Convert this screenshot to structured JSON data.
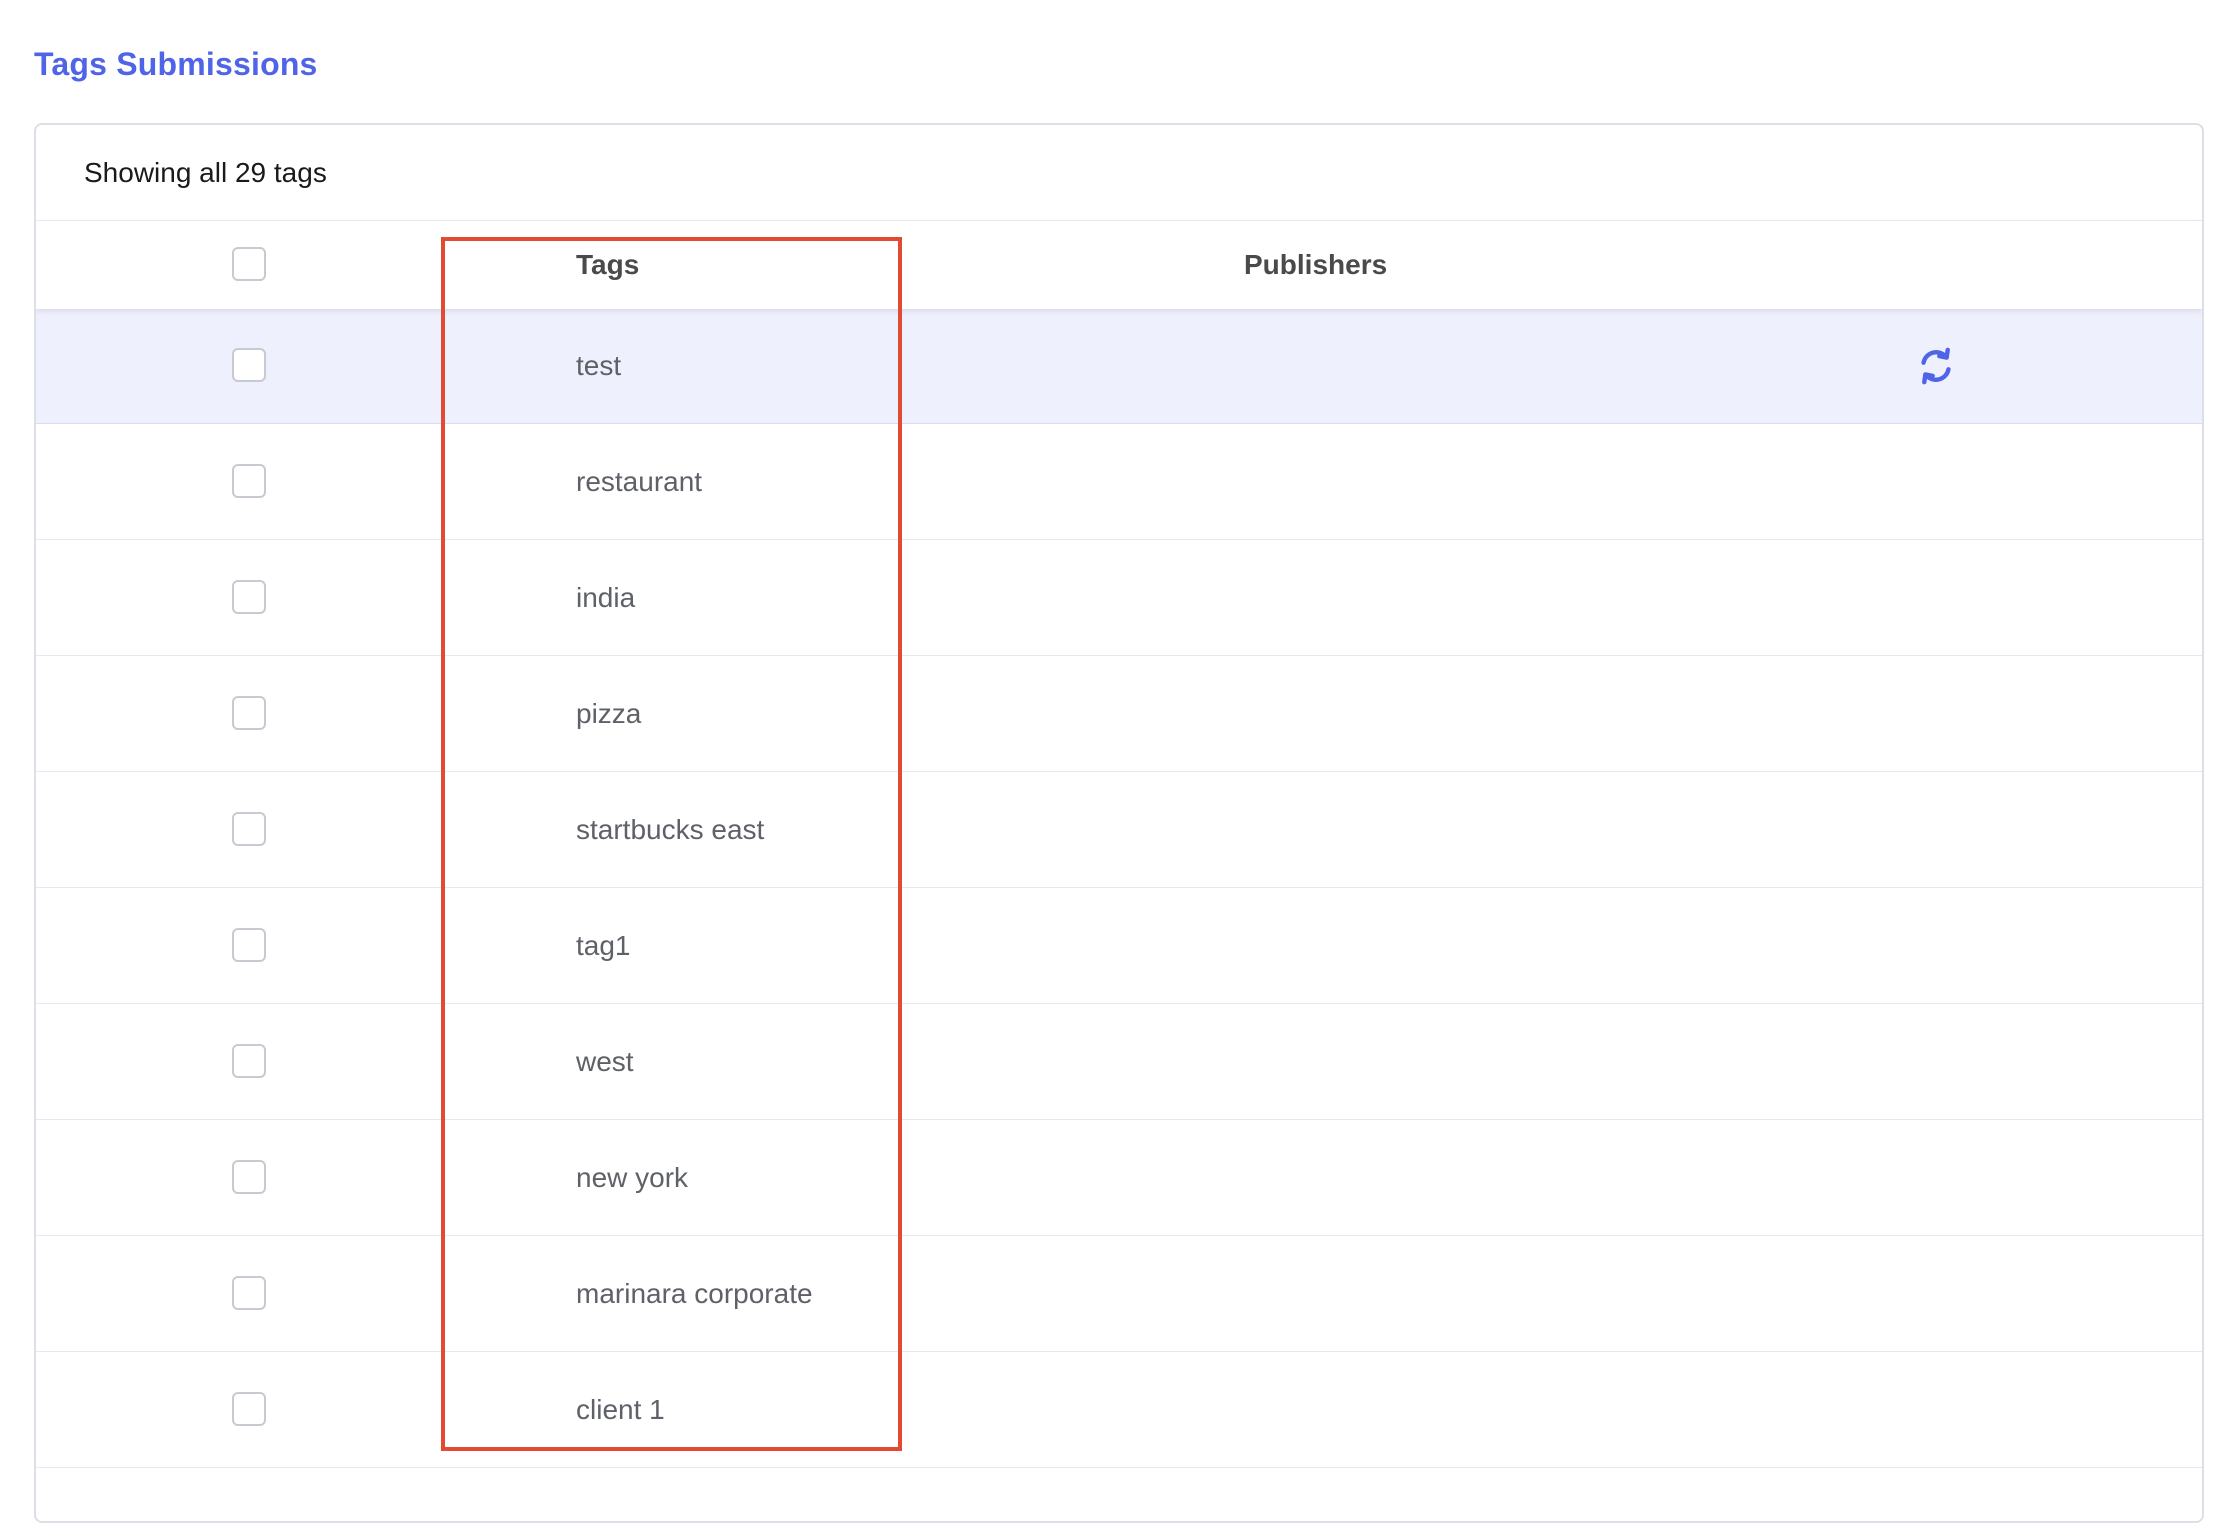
{
  "page": {
    "title": "Tags Submissions"
  },
  "table": {
    "summary": "Showing all 29 tags",
    "columns": {
      "tags": "Tags",
      "publishers": "Publishers"
    },
    "rows": [
      {
        "tag": "test",
        "active": true
      },
      {
        "tag": "restaurant"
      },
      {
        "tag": "india"
      },
      {
        "tag": "pizza"
      },
      {
        "tag": "startbucks east"
      },
      {
        "tag": "tag1"
      },
      {
        "tag": "west"
      },
      {
        "tag": "new york"
      },
      {
        "tag": "marinara corporate"
      },
      {
        "tag": "client 1"
      }
    ]
  },
  "icons": {
    "row_action": "sync-icon"
  },
  "colors": {
    "accent": "#4f64e6",
    "active_row": "#eef0fd",
    "highlight": "#e34a33"
  }
}
